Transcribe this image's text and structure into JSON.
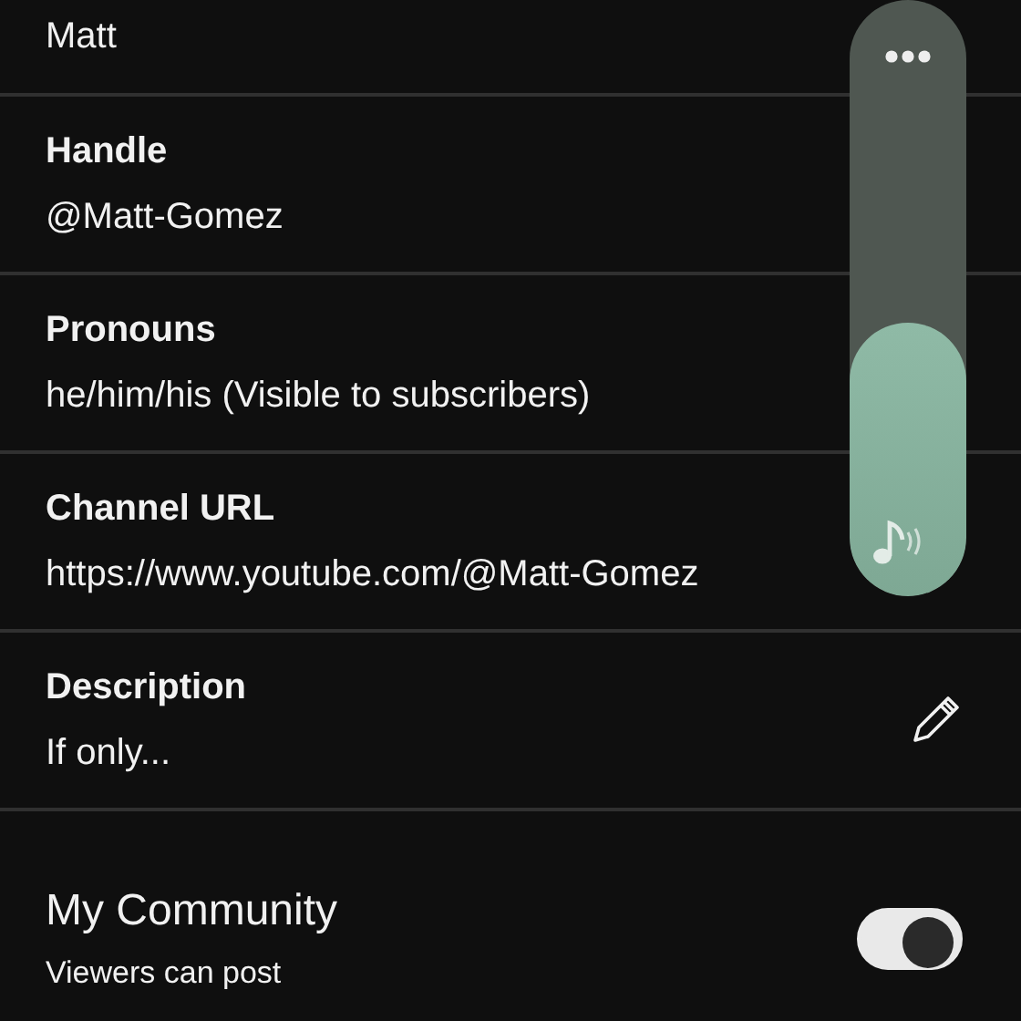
{
  "rows": [
    {
      "kind": "value_only",
      "value": "Matt"
    },
    {
      "kind": "field",
      "label": "Handle",
      "value": "@Matt-Gomez"
    },
    {
      "kind": "field",
      "label": "Pronouns",
      "value": "he/him/his (Visible to subscribers)"
    },
    {
      "kind": "field",
      "label": "Channel URL",
      "value": "https://www.youtube.com/@Matt-Gomez"
    },
    {
      "kind": "editable",
      "label": "Description",
      "value": "If only..."
    }
  ],
  "community": {
    "title": "My Community",
    "subtitle": "Viewers can post",
    "on": true
  },
  "volume_panel": {
    "level": 0.46
  }
}
